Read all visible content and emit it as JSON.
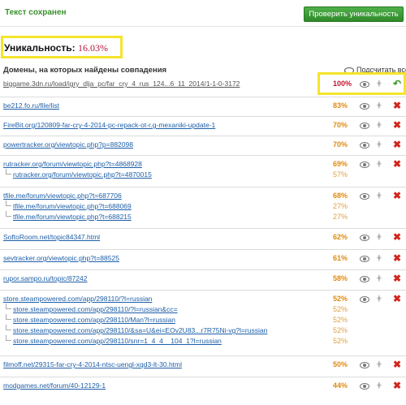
{
  "header": {
    "saved_text": "Текст сохранен",
    "check_button": "Проверить уникальность"
  },
  "uniqueness": {
    "label": "Уникальность:",
    "value": "16.03%"
  },
  "domains": {
    "title": "Домены, на которых найдены совпадения",
    "count_all": "Подсчитать все"
  },
  "results": [
    {
      "url": "biggame.3dn.ru/load/igry_dlja_pc/far_cry_4_rus_124...6_11_2014/1-1-0-3172",
      "pct": "100%",
      "excluded": true,
      "subs": []
    },
    {
      "url": "be212.fo.ru/file/list",
      "pct": "83%",
      "subs": []
    },
    {
      "url": "FireBit.org/120809-far-cry-4-2014-pc-repack-ot-r.g-mexaniki-update-1",
      "pct": "70%",
      "subs": []
    },
    {
      "url": "powertracker.org/viewtopic.php?p=882098",
      "pct": "70%",
      "subs": []
    },
    {
      "url": "rutracker.org/forum/viewtopic.php?t=4868928",
      "pct": "69%",
      "subs": [
        {
          "url": "rutracker.org/forum/viewtopic.php?t=4870015",
          "pct": "57%"
        }
      ]
    },
    {
      "url": "tfile.me/forum/viewtopic.php?t=687706",
      "pct": "68%",
      "subs": [
        {
          "url": "tfile.me/forum/viewtopic.php?t=688069",
          "pct": "27%"
        },
        {
          "url": "tfile.me/forum/viewtopic.php?t=688215",
          "pct": "27%"
        }
      ]
    },
    {
      "url": "SoftoRoom.net/topic84347.html",
      "pct": "62%",
      "subs": []
    },
    {
      "url": "sevtracker.org/viewtopic.php?t=88525",
      "pct": "61%",
      "subs": []
    },
    {
      "url": "rupor.sampo.ru/topic/87242",
      "pct": "58%",
      "subs": []
    },
    {
      "url": "store.steampowered.com/app/298110/?l=russian",
      "pct": "52%",
      "subs": [
        {
          "url": "store.steampowered.com/app/298110/?l=russian&cc=",
          "pct": "52%"
        },
        {
          "url": "store.steampowered.com/app/298110/Man?l=russian",
          "pct": "52%"
        },
        {
          "url": "store.steampowered.com/app/298110/&sa=U&ei=EOv2U83...r7R75Ni-vg?l=russian",
          "pct": "52%"
        },
        {
          "url": "store.steampowered.com/app/298110/snr=1_4_4__104_1?l=russian",
          "pct": "52%"
        }
      ]
    },
    {
      "url": "filmoff.net/29315-far-cry-4-2014-ntsc-uengl-xqd3-lt-30.html",
      "pct": "50%",
      "subs": []
    },
    {
      "url": "modgames.net/forum/40-12129-1",
      "pct": "44%",
      "subs": []
    }
  ],
  "colors": {
    "accent_green": "#3a8f2d",
    "highlight_yellow": "#f5e42b",
    "uniq_value": "#b0173c",
    "pct_orange": "#e08a10",
    "delete_red": "#d0271e"
  }
}
